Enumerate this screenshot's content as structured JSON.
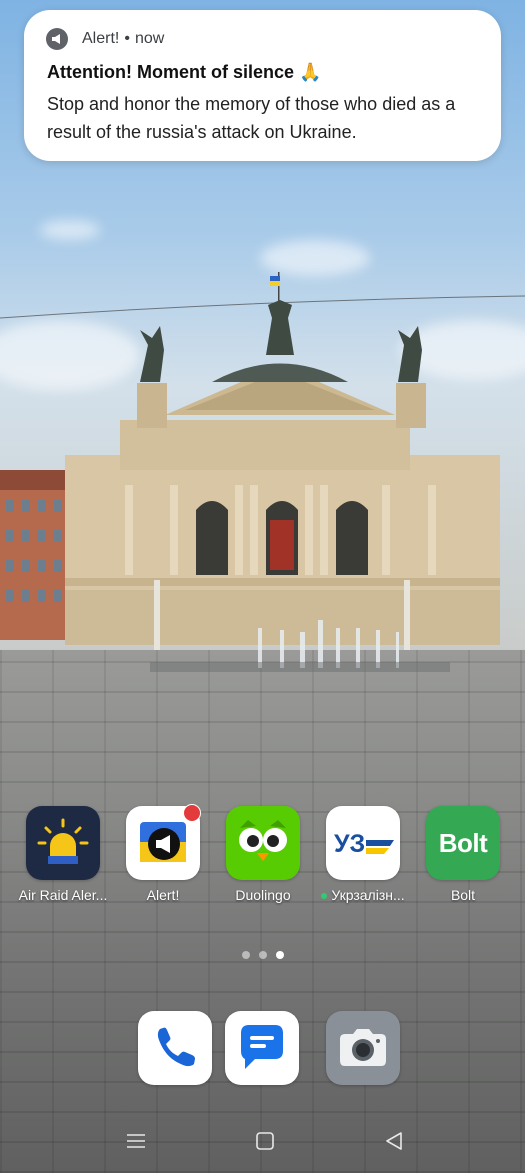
{
  "notification": {
    "app_name": "Alert!",
    "separator": "•",
    "time": "now",
    "title": "Attention! Moment of silence 🙏",
    "body": "Stop and honor the memory of those who died as a result of the russia's attack on Ukraine."
  },
  "apps": [
    {
      "label": "Air Raid Aler...",
      "icon": "air-raid-siren-icon"
    },
    {
      "label": "Alert!",
      "icon": "megaphone-icon",
      "has_badge": true
    },
    {
      "label": "Duolingo",
      "icon": "duolingo-owl-icon"
    },
    {
      "label": "Укрзалізн...",
      "icon": "uz-logo-icon",
      "new_dot": true
    },
    {
      "label": "Bolt",
      "icon": "bolt-logo-icon",
      "logo_text": "Bolt"
    }
  ],
  "uz_logo_text": "УЗ",
  "page_indicator": {
    "pages": 3,
    "current": 3
  },
  "dock": [
    {
      "icon": "phone-icon"
    },
    {
      "icon": "messages-icon"
    },
    {
      "icon": "camera-icon"
    }
  ],
  "nav": [
    "menu-icon",
    "home-icon",
    "back-icon"
  ],
  "colors": {
    "air_raid_bg": "#1e2a44",
    "siren_yellow": "#f5c518",
    "alert_blue": "#2f6fde",
    "duolingo_green": "#58cc02",
    "uz_blue": "#1a4fa0",
    "uz_yellow": "#f7c600",
    "bolt_green": "#34a853",
    "camera_gray": "#8a9097"
  }
}
